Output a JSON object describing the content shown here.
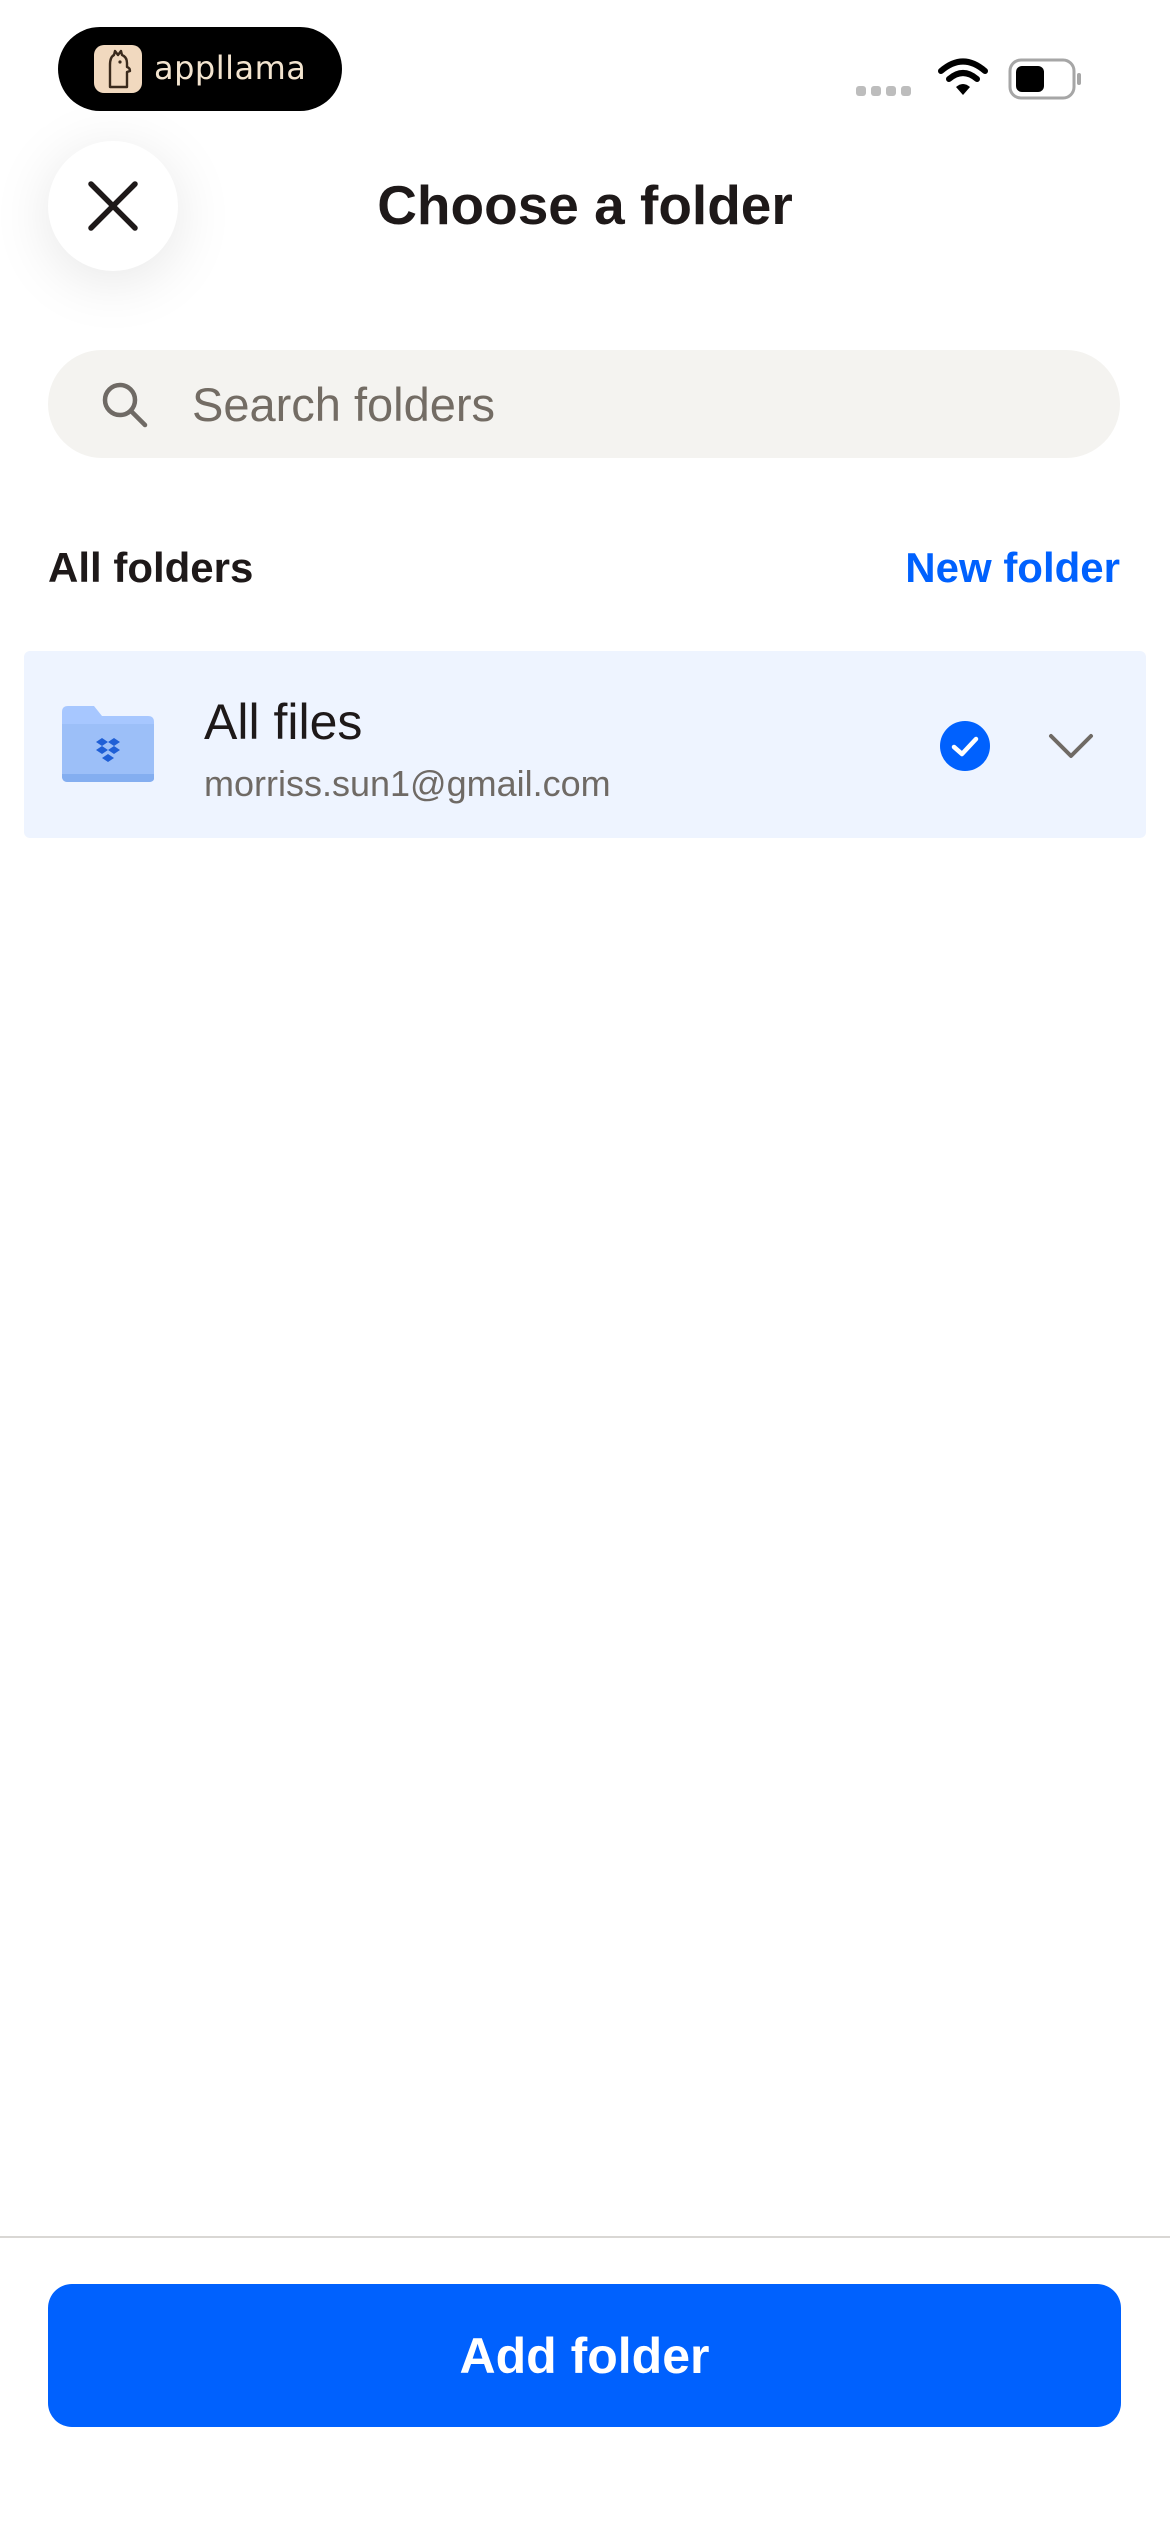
{
  "status_bar": {
    "brand_name": "appllama",
    "icons": [
      "appllama-logo-icon",
      "cellular-signal-icon",
      "wifi-icon",
      "battery-icon"
    ]
  },
  "header": {
    "close_icon": "close-icon",
    "title": "Choose a folder"
  },
  "search": {
    "icon": "search-icon",
    "placeholder": "Search folders",
    "value": ""
  },
  "section": {
    "label": "All folders",
    "action_label": "New folder"
  },
  "folders": [
    {
      "name": "All files",
      "account": "morriss.sun1@gmail.com",
      "icon": "dropbox-folder-icon",
      "selected": true,
      "expandable": true
    }
  ],
  "footer": {
    "primary_button_label": "Add folder"
  },
  "colors": {
    "accent": "#0061fe",
    "selected_row_bg": "#eef4ff",
    "search_bg": "#f4f3f0",
    "title_text": "#1e1919",
    "secondary_text": "#6f6a65",
    "folder_icon": "#a7c7ff"
  }
}
